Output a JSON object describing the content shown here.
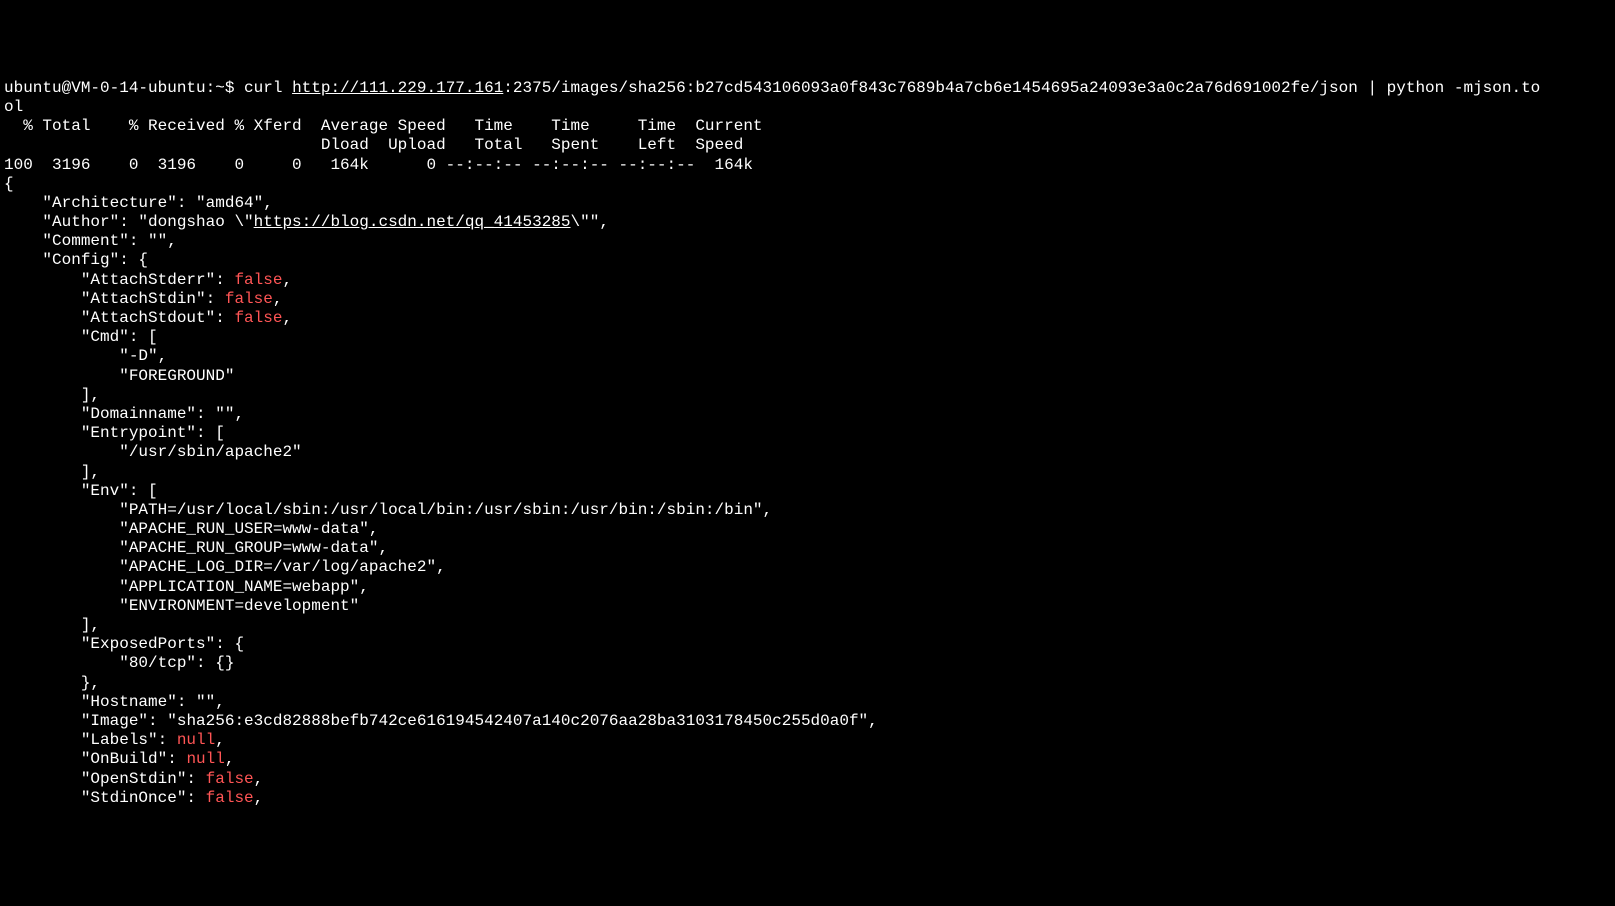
{
  "prompt": {
    "user_host": "ubuntu@VM-0-14-ubuntu",
    "path": ":~$",
    "cmd_prefix": " curl ",
    "url": "http://111.229.177.161",
    "url_suffix": ":2375/images/sha256:b27cd543106093a0f843c7689b4a7cb6e1454695a24093e3a0c2a76d691002fe/json | python -mjson.to",
    "wrap": "ol"
  },
  "curl_header": {
    "line1": "  % Total    % Received % Xferd  Average Speed   Time    Time     Time  Current",
    "line2": "                                 Dload  Upload   Total   Spent    Left  Speed",
    "line3": "100  3196    0  3196    0     0   164k      0 --:--:-- --:--:-- --:--:--  164k"
  },
  "json": {
    "open": "{",
    "arch_key": "    \"Architecture\": ",
    "arch_val": "\"amd64\"",
    "author_key": "    \"Author\": ",
    "author_pre": "\"dongshao \\\"",
    "author_url": "https://blog.csdn.net/qq_41453285",
    "author_post": "\\\"\"",
    "comment_key": "    \"Comment\": ",
    "comment_val": "\"\"",
    "config_open": "    \"Config\": {",
    "attach_stderr_key": "        \"AttachStderr\": ",
    "attach_stdin_key": "        \"AttachStdin\": ",
    "attach_stdout_key": "        \"AttachStdout\": ",
    "false_val": "false",
    "cmd_open": "        \"Cmd\": [",
    "cmd_item1": "            \"-D\",",
    "cmd_item2": "            \"FOREGROUND\"",
    "cmd_close": "        ],",
    "domain_key": "        \"Domainname\": ",
    "domain_val": "\"\"",
    "entry_open": "        \"Entrypoint\": [",
    "entry_item": "            \"/usr/sbin/apache2\"",
    "entry_close": "        ],",
    "env_open": "        \"Env\": [",
    "env_item1": "            \"PATH=/usr/local/sbin:/usr/local/bin:/usr/sbin:/usr/bin:/sbin:/bin\",",
    "env_item2": "            \"APACHE_RUN_USER=www-data\",",
    "env_item3": "            \"APACHE_RUN_GROUP=www-data\",",
    "env_item4": "            \"APACHE_LOG_DIR=/var/log/apache2\",",
    "env_item5": "            \"APPLICATION_NAME=webapp\",",
    "env_item6": "            \"ENVIRONMENT=development\"",
    "env_close": "        ],",
    "ports_open": "        \"ExposedPorts\": {",
    "ports_item": "            \"80/tcp\": {}",
    "ports_close": "        },",
    "hostname_key": "        \"Hostname\": ",
    "hostname_val": "\"\"",
    "image_key": "        \"Image\": ",
    "image_val": "\"sha256:e3cd82888befb742ce616194542407a140c2076aa28ba3103178450c255d0a0f\"",
    "labels_key": "        \"Labels\": ",
    "null_val": "null",
    "onbuild_key": "        \"OnBuild\": ",
    "openstdin_key": "        \"OpenStdin\": ",
    "stdinonce_key": "        \"StdinOnce\": ",
    "comma": ","
  }
}
